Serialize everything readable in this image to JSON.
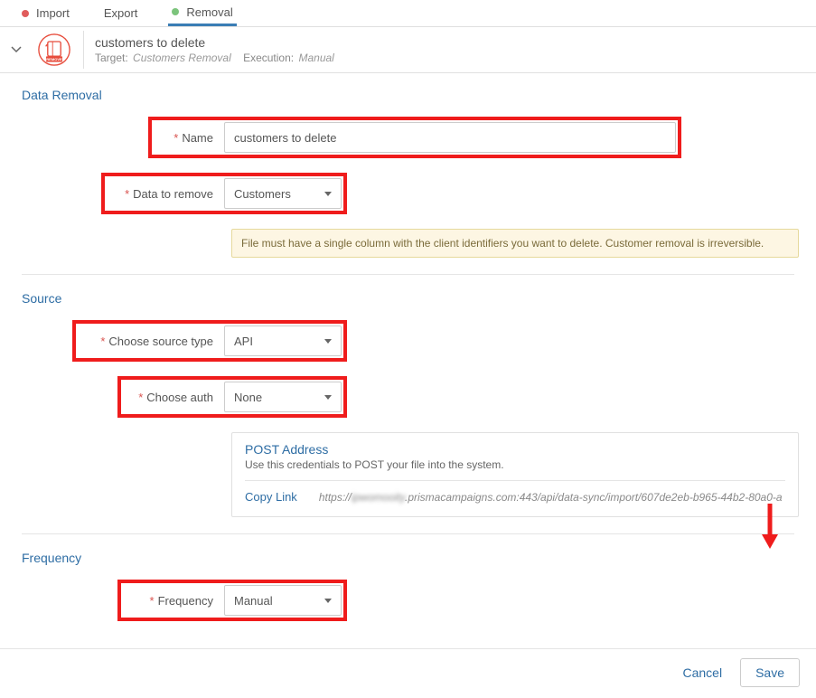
{
  "tabs": {
    "import": "Import",
    "export": "Export",
    "removal": "Removal"
  },
  "header": {
    "title": "customers to delete",
    "target_label": "Target:",
    "target_value": "Customers Removal",
    "execution_label": "Execution:",
    "execution_value": "Manual"
  },
  "sections": {
    "data_removal": "Data Removal",
    "source": "Source",
    "frequency": "Frequency"
  },
  "fields": {
    "name_label": "Name",
    "name_value": "customers to delete",
    "data_to_remove_label": "Data to remove",
    "data_to_remove_value": "Customers",
    "choose_source_label": "Choose source type",
    "choose_source_value": "API",
    "choose_auth_label": "Choose auth",
    "choose_auth_value": "None",
    "frequency_label": "Frequency",
    "frequency_value": "Manual"
  },
  "warning": "File must have a single column with the client identifiers you want to delete. Customer removal is irreversible.",
  "post_box": {
    "title": "POST Address",
    "subtitle": "Use this credentials to POST your file into the system.",
    "copy_link": "Copy Link",
    "url_prefix": "https://",
    "url_blur": "ipwomooity",
    "url_suffix": ".prismacampaigns.com:443/api/data-sync/import/607de2eb-b965-44b2-80a0-a"
  },
  "footer": {
    "cancel": "Cancel",
    "save": "Save"
  }
}
